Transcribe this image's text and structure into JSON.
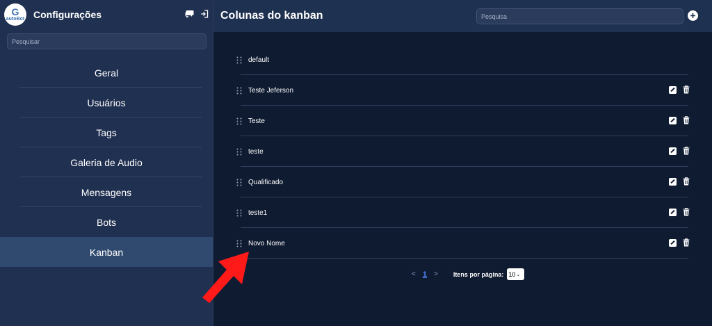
{
  "sidebar": {
    "logo_text": "autoBot",
    "title": "Configurações",
    "search_placeholder": "Pesquisar",
    "items": [
      {
        "label": "Geral"
      },
      {
        "label": "Usuários"
      },
      {
        "label": "Tags"
      },
      {
        "label": "Galeria de Audio"
      },
      {
        "label": "Mensagens"
      },
      {
        "label": "Bots"
      },
      {
        "label": "Kanban"
      }
    ],
    "active_item": "Kanban"
  },
  "header": {
    "title": "Colunas do kanban",
    "search_placeholder": "Pesquisa"
  },
  "columns": [
    {
      "label": "default",
      "actions": false
    },
    {
      "label": "Teste Jeferson",
      "actions": true
    },
    {
      "label": "Teste",
      "actions": true
    },
    {
      "label": "teste",
      "actions": true
    },
    {
      "label": "Qualificado",
      "actions": true
    },
    {
      "label": "teste1",
      "actions": true
    },
    {
      "label": "Novo Nome",
      "actions": true
    }
  ],
  "pagination": {
    "prev": "<",
    "current": "1",
    "next": ">",
    "per_page_label": "Itens por página:",
    "per_page_value": "10"
  },
  "colors": {
    "sidebar_bg": "#203050",
    "main_bg": "#0f1b31",
    "active_item_bg": "#2f4a6e",
    "annotation_arrow": "#ff1a1a"
  }
}
